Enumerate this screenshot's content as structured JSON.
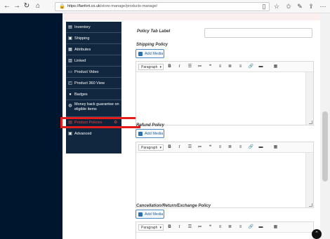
{
  "browser": {
    "url_host": "https://fanfort.co.uk",
    "url_path": "/store-manage/products-manage/",
    "back_icon": "←",
    "forward_icon": "→",
    "reload_icon": "↻",
    "home_icon": "⌂",
    "lock_icon": "🔒",
    "reading_icon": "▯",
    "star_icon": "☆",
    "favorites_icon": "✩",
    "pen_icon": "✎",
    "share_icon": "⇪",
    "more_icon": "⋯"
  },
  "sidebar": {
    "items": [
      {
        "label": "Inventory",
        "icon": "▤"
      },
      {
        "label": "Shipping",
        "icon": "▣"
      },
      {
        "label": "Attributes",
        "icon": "▦"
      },
      {
        "label": "Linked",
        "icon": "▥"
      },
      {
        "label": "Product Video",
        "icon": "▭"
      },
      {
        "label": "Product 360 View",
        "icon": "◰"
      },
      {
        "label": "Badges",
        "icon": "●"
      },
      {
        "label": "Money back guarantee on eligible items",
        "icon": "◍"
      },
      {
        "label": "Product Policies",
        "icon": "▤",
        "badge_icon": "⚙"
      },
      {
        "label": "Advanced",
        "icon": "▣"
      }
    ]
  },
  "form": {
    "policy_tab_label": "Policy Tab Label",
    "policy_tab_value": "",
    "shipping_policy": "Shipping Policy",
    "refund_policy": "Refund Policy",
    "cancellation_policy": "Cancellation/Return/Exchange Policy",
    "add_media_label": "Add Media",
    "format_select": "Paragraph",
    "toolbar": {
      "caret": "▾",
      "bold": "B",
      "italic": "I",
      "bullets": "☰",
      "numbered": "≔",
      "quote": "❝",
      "align_left": "≡",
      "align_center": "≣",
      "align_right": "≡",
      "link": "🔗",
      "more": "▬",
      "kitchen_sink": "▦"
    }
  },
  "scroll_top_icon": "⌃",
  "colors": {
    "left_panel": "#00152e",
    "menu_bg": "#11273f",
    "active_text": "#e64a4a",
    "highlight_border": "#e21b1b",
    "add_media_border": "#4c8ac5"
  }
}
